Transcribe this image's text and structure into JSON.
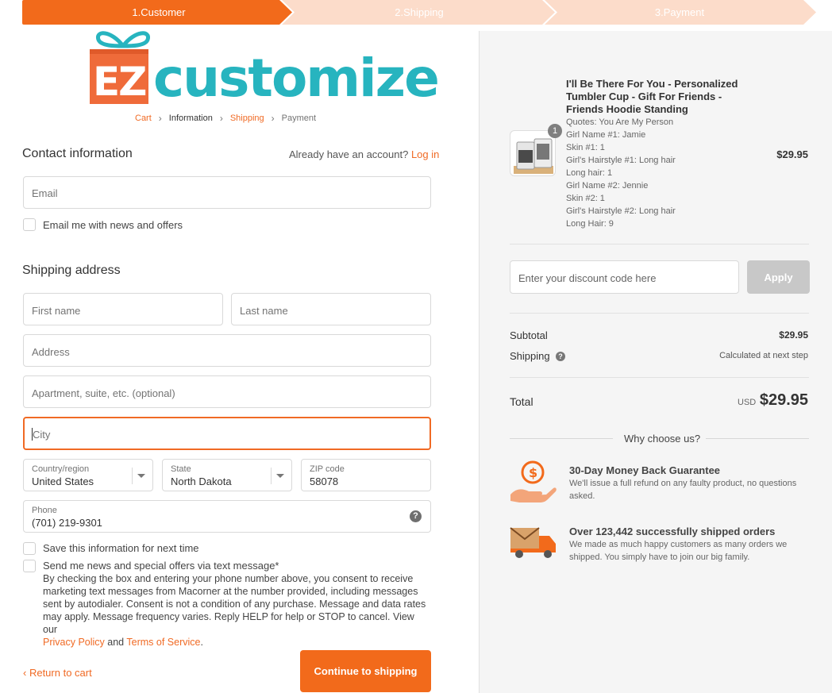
{
  "steps": [
    {
      "label": "1.Customer"
    },
    {
      "label": "2.Shipping"
    },
    {
      "label": "3.Payment"
    }
  ],
  "logo": {
    "ez": "EZ",
    "text": "customize"
  },
  "breadcrumb": {
    "cart": "Cart",
    "information": "Information",
    "shipping": "Shipping",
    "payment": "Payment"
  },
  "contact": {
    "title": "Contact information",
    "account_prompt": "Already have an account?",
    "login": "Log in",
    "email_placeholder": "Email",
    "news_checkbox": "Email me with news and offers"
  },
  "shipping": {
    "title": "Shipping address",
    "first_name": "First name",
    "last_name": "Last name",
    "address": "Address",
    "apartment": "Apartment, suite, etc. (optional)",
    "city": "City",
    "country_label": "Country/region",
    "country_value": "United States",
    "state_label": "State",
    "state_value": "North Dakota",
    "zip_label": "ZIP code",
    "zip_value": "58078",
    "phone_label": "Phone",
    "phone_value": "(701) 219-9301",
    "save_info": "Save this information for next time",
    "sms_checkbox": "Send me news and special offers via text message*",
    "sms_legal": "By checking the box and entering your phone number above, you consent to receive marketing text messages from Macorner at the number provided, including messages sent by autodialer. Consent is not a condition of any purchase. Message and data rates may apply. Message frequency varies. Reply HELP for help or STOP to cancel. View our",
    "privacy": "Privacy Policy",
    "and": "and",
    "terms": "Terms of Service",
    "period": "."
  },
  "footer": {
    "return": "Return to cart",
    "continue": "Continue to shipping"
  },
  "product": {
    "qty": "1",
    "title": "I'll Be There For You - Personalized Tumbler Cup - Gift For Friends - Friends Hoodie Standing",
    "options": [
      "Quotes: You Are My Person",
      "Girl Name #1: Jamie",
      "Skin #1: 1",
      "Girl's Hairstyle #1: Long hair",
      "Long hair: 1",
      "Girl Name #2: Jennie",
      "Skin #2: 1",
      "Girl's Hairstyle #2: Long hair",
      "Long Hair: 9"
    ],
    "price": "$29.95"
  },
  "discount": {
    "placeholder": "Enter your discount code here",
    "apply": "Apply"
  },
  "summary": {
    "subtotal_label": "Subtotal",
    "subtotal_value": "$29.95",
    "shipping_label": "Shipping",
    "shipping_value": "Calculated at next step",
    "total_label": "Total",
    "currency": "USD",
    "total_value": "$29.95"
  },
  "why": {
    "title": "Why choose us?",
    "items": [
      {
        "title": "30-Day Money Back Guarantee",
        "desc": "We'll issue a full refund on any faulty product, no questions asked."
      },
      {
        "title": "Over 123,442 successfully shipped orders",
        "desc": "We made as much happy customers as many orders we shipped. You simply have to join our big family."
      }
    ]
  },
  "colors": {
    "accent": "#f26a1b",
    "brand_teal": "#27b4bf",
    "step_inactive": "#fbd9c6"
  }
}
